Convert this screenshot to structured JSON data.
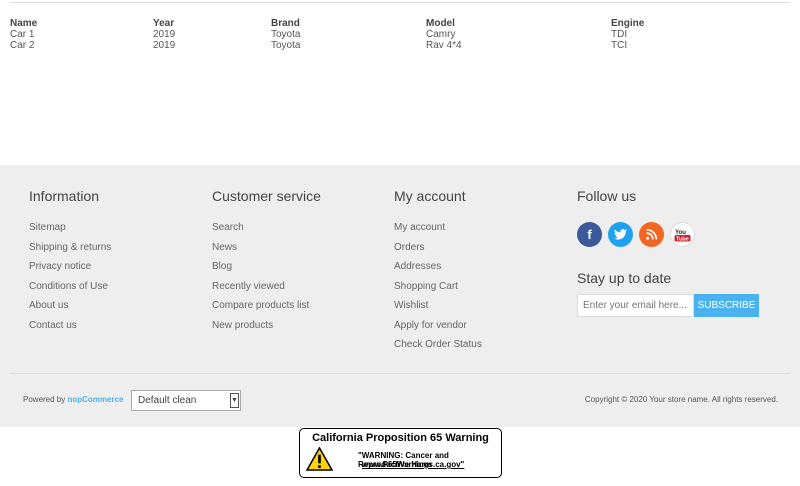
{
  "table": {
    "headers": [
      "Name",
      "Year",
      "Brand",
      "Model",
      "Engine"
    ],
    "rows": [
      [
        "Car 1",
        "2019",
        "Toyota",
        "Camry",
        "TDI"
      ],
      [
        "Car 2",
        "2019",
        "Toyota",
        "Rav 4*4",
        "TCI"
      ]
    ]
  },
  "footer": {
    "information": {
      "title": "Information",
      "links": [
        "Sitemap",
        "Shipping & returns",
        "Privacy notice",
        "Conditions of Use",
        "About us",
        "Contact us"
      ]
    },
    "customer_service": {
      "title": "Customer service",
      "links": [
        "Search",
        "News",
        "Blog",
        "Recently viewed",
        "Compare products list",
        "New products"
      ]
    },
    "my_account": {
      "title": "My account",
      "links": [
        "My account",
        "Orders",
        "Addresses",
        "Shopping Cart",
        "Wishlist",
        "Apply for vendor",
        "Check Order Status"
      ]
    },
    "follow": {
      "title": "Follow us",
      "icons": [
        "facebook-icon",
        "twitter-icon",
        "rss-icon",
        "youtube-icon"
      ]
    },
    "newsletter": {
      "title": "Stay up to date",
      "placeholder": "Enter your email here...",
      "button": "SUBSCRIBE"
    },
    "powered_by_prefix": "Powered by",
    "powered_by_brand": "nopCommerce",
    "theme_selected": "Default clean",
    "copyright": "Copyright © 2020 Your store name. All rights reserved."
  },
  "prop65": {
    "title": "California Proposition 65 Warning",
    "warning": "\"WARNING: Cancer and Reproductive Harm",
    "url": "www.P65Warnings.ca.gov\""
  },
  "colors": {
    "accent": "#4ab2f1",
    "footer_bg": "#eeeeee"
  }
}
